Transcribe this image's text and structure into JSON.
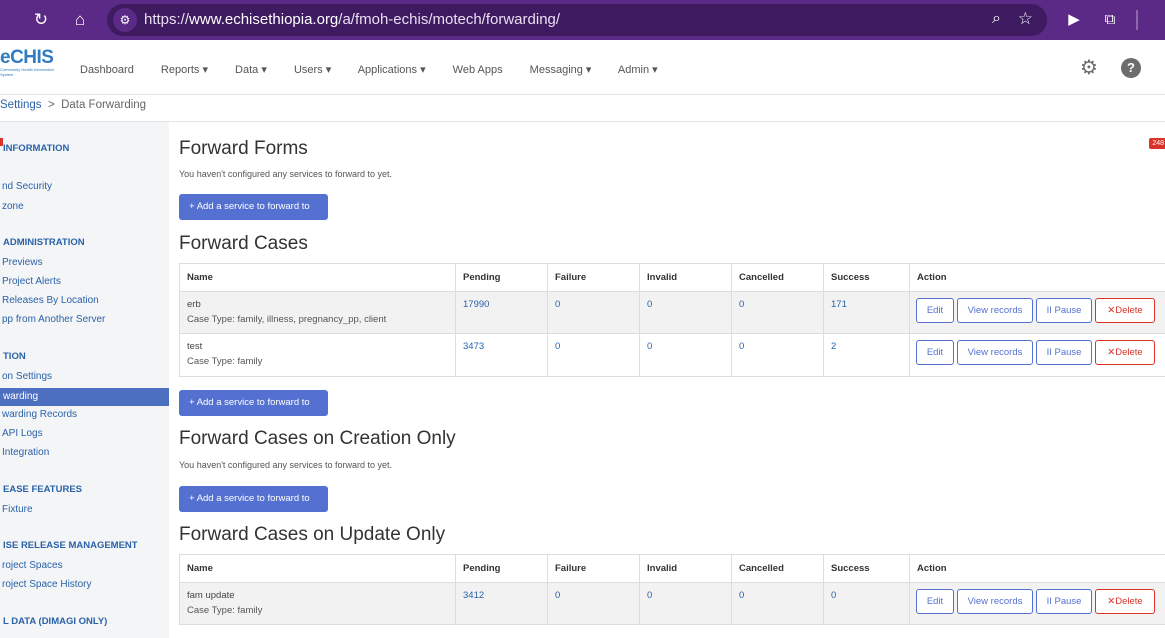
{
  "browser": {
    "url_prefix": "https://",
    "url_host": "www.echisethiopia.org",
    "url_path": "/a/fmoh-echis/motech/forwarding/",
    "reload_glyph": "↻",
    "home_glyph": "⌂",
    "site_glyph": "⚙",
    "zoom_glyph": "⌕",
    "star_glyph": "☆",
    "ext1_glyph": "▶",
    "ext2_glyph": "⧉",
    "menu_glyph": "⋮"
  },
  "app": {
    "logo_text": "eCHIS",
    "logo_sub": "Community Health Information System",
    "menu": [
      "Dashboard",
      "Reports ▾",
      "Data ▾",
      "Users ▾",
      "Applications ▾",
      "Web Apps",
      "Messaging ▾",
      "Admin ▾"
    ],
    "gear_glyph": "⚙",
    "help_glyph": "?"
  },
  "breadcrumb": {
    "parent": "Settings",
    "sep": ">",
    "current": "Data Forwarding"
  },
  "sidebar": {
    "sections": [
      {
        "title": "INFORMATION",
        "items": [
          "nd Security",
          "zone"
        ]
      },
      {
        "title": "ADMINISTRATION",
        "items": [
          "Previews",
          "Project Alerts",
          "Releases By Location",
          "pp from Another Server"
        ]
      },
      {
        "title": "TION",
        "items": [
          "on Settings",
          "warding",
          "warding Records",
          "API Logs",
          "Integration"
        ]
      },
      {
        "title": "EASE FEATURES",
        "items": [
          "Fixture"
        ]
      },
      {
        "title": "ISE RELEASE MANAGEMENT",
        "items": [
          "roject Spaces",
          "roject Space History"
        ]
      },
      {
        "title": "L DATA (DIMAGI ONLY)",
        "items": []
      }
    ]
  },
  "badge": "248",
  "sections": {
    "forms": {
      "title": "Forward Forms",
      "note": "You haven't configured any services to forward to yet.",
      "add_label": "Add a service to forward to"
    },
    "cases": {
      "title": "Forward Cases",
      "add_label": "Add a service to forward to"
    },
    "creation": {
      "title": "Forward Cases on Creation Only",
      "note": "You haven't configured any services to forward to yet.",
      "add_label": "Add a service to forward to"
    },
    "update": {
      "title": "Forward Cases on Update Only"
    }
  },
  "table_headers": [
    "Name",
    "Pending",
    "Failure",
    "Invalid",
    "Cancelled",
    "Success",
    "Action"
  ],
  "cases_rows": [
    {
      "name": "erb",
      "case_type": "Case Type: family, illness, pregnancy_pp, client",
      "pending": "17990",
      "failure": "0",
      "invalid": "0",
      "cancelled": "0",
      "success": "171"
    },
    {
      "name": "test",
      "case_type": "Case Type: family",
      "pending": "3473",
      "failure": "0",
      "invalid": "0",
      "cancelled": "0",
      "success": "2"
    }
  ],
  "update_rows": [
    {
      "name": "fam update",
      "case_type": "Case Type: family",
      "pending": "3412",
      "failure": "0",
      "invalid": "0",
      "cancelled": "0",
      "success": "0"
    }
  ],
  "actions": {
    "edit": "Edit",
    "view": "View records",
    "pause": "Pause",
    "delete": "Delete",
    "pause_glyph": "II",
    "delete_glyph": "✕",
    "plus_glyph": "+"
  }
}
